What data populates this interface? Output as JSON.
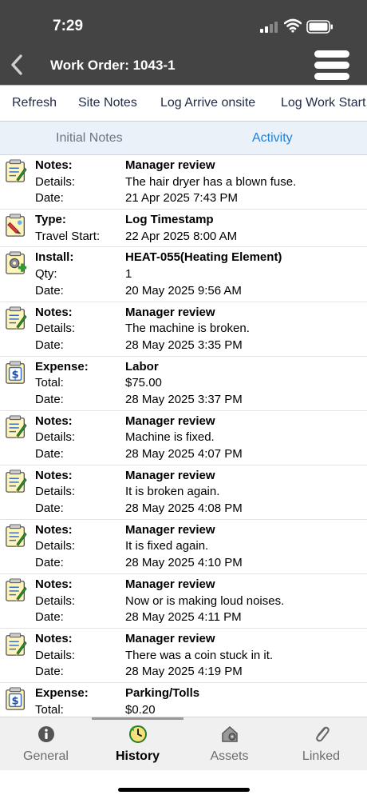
{
  "status_bar": {
    "time": "7:29"
  },
  "header": {
    "title": "Work Order: 1043-1"
  },
  "actions": [
    "Refresh",
    "Site Notes",
    "Log Arrive onsite",
    "Log Work Start"
  ],
  "subtabs": {
    "items": [
      "Initial Notes",
      "Activity"
    ],
    "active": "Activity"
  },
  "activity": [
    {
      "icon": "notes-icon",
      "lines": [
        {
          "label": "Notes:",
          "value": "Manager review",
          "bold": true
        },
        {
          "label": "Details:",
          "value": "The hair dryer has a blown fuse."
        },
        {
          "label": "Date:",
          "value": "21 Apr 2025 7:43 PM"
        }
      ]
    },
    {
      "icon": "timestamp-icon",
      "lines": [
        {
          "label": "Type:",
          "value": "Log Timestamp",
          "bold": true
        },
        {
          "label": "Travel Start:",
          "value": "22 Apr 2025 8:00 AM"
        }
      ]
    },
    {
      "icon": "install-icon",
      "lines": [
        {
          "label": "Install:",
          "value": "HEAT-055(Heating Element)",
          "bold": true
        },
        {
          "label": "Qty:",
          "value": "1"
        },
        {
          "label": "Date:",
          "value": "20 May 2025 9:56 AM"
        }
      ]
    },
    {
      "icon": "notes-icon",
      "lines": [
        {
          "label": "Notes:",
          "value": "Manager review",
          "bold": true
        },
        {
          "label": "Details:",
          "value": "The machine is broken."
        },
        {
          "label": "Date:",
          "value": "28 May 2025 3:35 PM"
        }
      ]
    },
    {
      "icon": "expense-icon",
      "lines": [
        {
          "label": "Expense:",
          "value": "Labor",
          "bold": true
        },
        {
          "label": "Total:",
          "value": "$75.00"
        },
        {
          "label": "Date:",
          "value": "28 May 2025 3:37 PM"
        }
      ]
    },
    {
      "icon": "notes-icon",
      "lines": [
        {
          "label": "Notes:",
          "value": "Manager review",
          "bold": true
        },
        {
          "label": "Details:",
          "value": "Machine is fixed."
        },
        {
          "label": "Date:",
          "value": "28 May 2025 4:07 PM"
        }
      ]
    },
    {
      "icon": "notes-icon",
      "lines": [
        {
          "label": "Notes:",
          "value": "Manager review",
          "bold": true
        },
        {
          "label": "Details:",
          "value": "It is broken again."
        },
        {
          "label": "Date:",
          "value": "28 May 2025 4:08 PM"
        }
      ]
    },
    {
      "icon": "notes-icon",
      "lines": [
        {
          "label": "Notes:",
          "value": "Manager review",
          "bold": true
        },
        {
          "label": "Details:",
          "value": "It is fixed again."
        },
        {
          "label": "Date:",
          "value": "28 May 2025 4:10 PM"
        }
      ]
    },
    {
      "icon": "notes-icon",
      "lines": [
        {
          "label": "Notes:",
          "value": "Manager review",
          "bold": true
        },
        {
          "label": "Details:",
          "value": "Now or is making loud noises."
        },
        {
          "label": "Date:",
          "value": "28 May 2025 4:11 PM"
        }
      ]
    },
    {
      "icon": "notes-icon",
      "lines": [
        {
          "label": "Notes:",
          "value": "Manager review",
          "bold": true
        },
        {
          "label": "Details:",
          "value": "There was a coin stuck in it."
        },
        {
          "label": "Date:",
          "value": "28 May 2025 4:19 PM"
        }
      ]
    },
    {
      "icon": "expense-icon",
      "lines": [
        {
          "label": "Expense:",
          "value": "Parking/Tolls",
          "bold": true
        },
        {
          "label": "Total:",
          "value": "$0.20"
        }
      ]
    }
  ],
  "tabbar": {
    "items": [
      {
        "label": "General",
        "icon": "info-icon"
      },
      {
        "label": "History",
        "icon": "history-icon"
      },
      {
        "label": "Assets",
        "icon": "assets-icon"
      },
      {
        "label": "Linked",
        "icon": "paperclip-icon"
      }
    ],
    "active": "History"
  },
  "colors": {
    "header_bg": "#444444",
    "accent": "#1e7fd8",
    "subtab_bg": "#eaf1f9"
  }
}
